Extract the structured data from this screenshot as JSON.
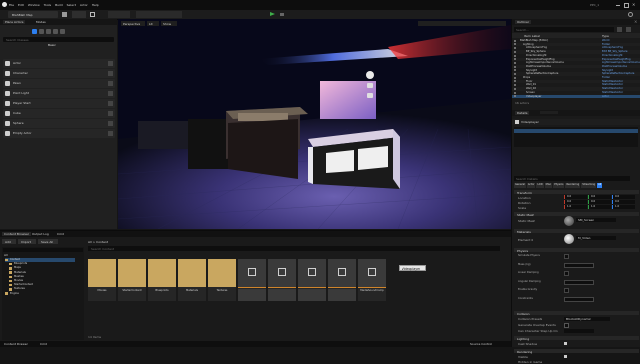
{
  "window": {
    "title": "BlahBlah Map",
    "product": "Unreal Editor",
    "project_label": "PPC_1"
  },
  "menu": [
    "File",
    "Edit",
    "Window",
    "Tools",
    "Build",
    "Select",
    "Actor",
    "Help"
  ],
  "toolbar": {
    "save_label": "Save",
    "mode_label": "Selection Mode",
    "platforms_label": "Platforms"
  },
  "left_panel": {
    "tabs": [
      "Place Actors",
      "Modes"
    ],
    "search_placeholder": "Search Classes",
    "category": "Basic",
    "items": [
      "Actor",
      "Character",
      "Pawn",
      "Point Light",
      "Player Start",
      "Cube",
      "Sphere",
      "Empty Actor"
    ]
  },
  "viewport": {
    "buttons": [
      "Perspective",
      "Lit",
      "Show"
    ],
    "tooltip": "Videoplayer"
  },
  "outliner": {
    "tab": "Outliner",
    "search_placeholder": "Search...",
    "col_label": "Item Label",
    "col_type": "Type",
    "rows": [
      [
        "BlahBlah Map (Editor)",
        "World"
      ],
      [
        "Lighting",
        "Folder"
      ],
      [
        "AtmosphericFog",
        "AtmosphericFog"
      ],
      [
        "BP_Sky_Sphere",
        "Edit BP_Sky_Sphere"
      ],
      [
        "DirectionalLight",
        "DirectionalLight"
      ],
      [
        "ExponentialHeightFog",
        "ExponentialHeightFog"
      ],
      [
        "LightmassImportanceVolume",
        "LightmassImportanceVolume"
      ],
      [
        "PostProcessVolume",
        "PostProcessVolume"
      ],
      [
        "SkyLight",
        "SkyLight"
      ],
      [
        "SphereReflectionCapture",
        "SphereReflectionCapture"
      ],
      [
        "Props",
        "Folder"
      ],
      [
        "Floor",
        "StaticMeshActor"
      ],
      [
        "Wall_01",
        "StaticMeshActor"
      ],
      [
        "Wall_02",
        "StaticMeshActor"
      ],
      [
        "Screen",
        "StaticMeshActor"
      ],
      [
        "Videoplayer",
        "Actor"
      ]
    ],
    "footer": "16 actors"
  },
  "details": {
    "tab": "Details",
    "selected": "Videoplayer",
    "search_placeholder": "Search Details",
    "filter_tabs": [
      "General",
      "Actor",
      "LOD",
      "Misc",
      "Physics",
      "Rendering",
      "Streaming",
      "All"
    ],
    "sections": [
      "Transform",
      "Static Mesh",
      "Materials",
      "Physics",
      "Collision",
      "Lighting",
      "Rendering"
    ],
    "transform_labels": [
      "Location",
      "Rotation",
      "Scale"
    ],
    "transform_values": [
      [
        "0.0",
        "0.0",
        "0.0"
      ],
      [
        "0.0",
        "0.0",
        "0.0"
      ],
      [
        "1.0",
        "1.0",
        "1.0"
      ]
    ],
    "props": [
      "Static Mesh",
      "Element 0",
      "Simulate Physics",
      "Mass (kg)",
      "Linear Damping",
      "Angular Damping",
      "Enable Gravity",
      "Constraints",
      "Collision Presets",
      "Generate Overlap Events",
      "Can Character Step Up On",
      "Cast Shadow",
      "Visible",
      "Hidden in Game"
    ],
    "mesh_name": "SM_Screen",
    "material_name": "M_Video",
    "preset_value": "BlockAllDynamic"
  },
  "content_browser": {
    "tabs": [
      "Content Browser",
      "Output Log",
      "Cmd"
    ],
    "add_label": "Add",
    "import_label": "Import",
    "save_all_label": "Save All",
    "path": "All > Content",
    "search_placeholder": "Search Content",
    "tree_root": "All",
    "tree": [
      "Content",
      "Blueprints",
      "Maps",
      "Materials",
      "Meshes",
      "Movies",
      "StarterContent",
      "Textures",
      "Engine"
    ],
    "folders": [
      "Movies",
      "StarterContent",
      "Blueprints",
      "Materials",
      "Textures"
    ],
    "assets": [
      "NewMediaPlayer",
      "MediaPlayer_Vid",
      "NewFileMedia",
      "NewMediaTexture",
      "MediaSoundComp",
      "Videoplayer_BP",
      "Videoplayer",
      "NewMaterial",
      "SM_Screen"
    ],
    "footer": "14 items"
  },
  "status": {
    "left": "Content Drawer",
    "mid": "Cmd",
    "right": "Source Control"
  },
  "colors": {
    "accent": "#2d7ff0",
    "folder": "#c9a760",
    "asset_bar": "#d0852b"
  }
}
